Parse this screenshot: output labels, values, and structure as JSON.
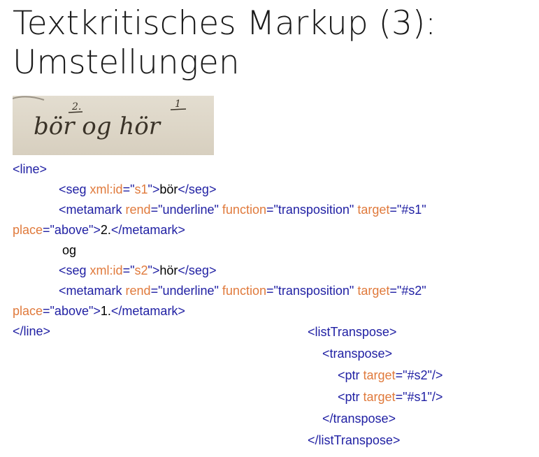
{
  "title": {
    "line1": "Textkritisches Markup (3):",
    "line2": "Umstellungen"
  },
  "image": {
    "description_alt": "",
    "colors": {
      "paper": "#ddd6c7",
      "ink": "#3a3328"
    }
  },
  "colors": {
    "tag": "#1f1fa3",
    "attribute": "#e07a3c",
    "text": "#000000"
  },
  "code1": {
    "l1_tag": "<line>",
    "l2_open": "<seg ",
    "l2_attr": "xml:id",
    "l2_eq": "=\"",
    "l2_val": "s1",
    "l2_close": "\">",
    "l2_text": "bör",
    "l2_end": "</seg>",
    "l3_open": "<metamark ",
    "l3_attr1": "rend",
    "l3_val1": "=\"underline\"",
    "l3_attr2": " function",
    "l3_val2": "=\"transposition\"",
    "l3_attr3": " target",
    "l3_val3": "=\"#s1\"",
    "l4_attr": "place",
    "l4_val": "=\"above\"",
    "l4_close": ">",
    "l4_text": "2.",
    "l4_end": "</metamark>",
    "l5_text": "og",
    "l6_open": "<seg ",
    "l6_attr": "xml:id",
    "l6_eq": "=\"",
    "l6_val": "s2",
    "l6_close": "\">",
    "l6_text": "hör",
    "l6_end": "</seg>",
    "l7_open": "<metamark ",
    "l7_attr1": "rend",
    "l7_val1": "=\"underline\"",
    "l7_attr2": " function",
    "l7_val2": "=\"transposition\"",
    "l7_attr3": " target",
    "l7_val3": "=\"#s2\"",
    "l8_attr": "place",
    "l8_val": "=\"above\"",
    "l8_close": ">",
    "l8_text": "1.",
    "l8_end": "</metamark>",
    "l9_tag": "</line>"
  },
  "code2": {
    "l1": "<listTranspose>",
    "l2": "<transpose>",
    "l3_open": "<ptr ",
    "l3_attr": "target",
    "l3_val": "=\"#s2\"",
    "l3_end": "/>",
    "l4_open": "<ptr ",
    "l4_attr": "target",
    "l4_val": "=\"#s1\"",
    "l4_end": "/>",
    "l5": "</transpose>",
    "l6": "</listTranspose>"
  },
  "manuscript_text": {
    "top_mark_left": "2.",
    "top_mark_right": "1",
    "words": "bör og hör"
  }
}
